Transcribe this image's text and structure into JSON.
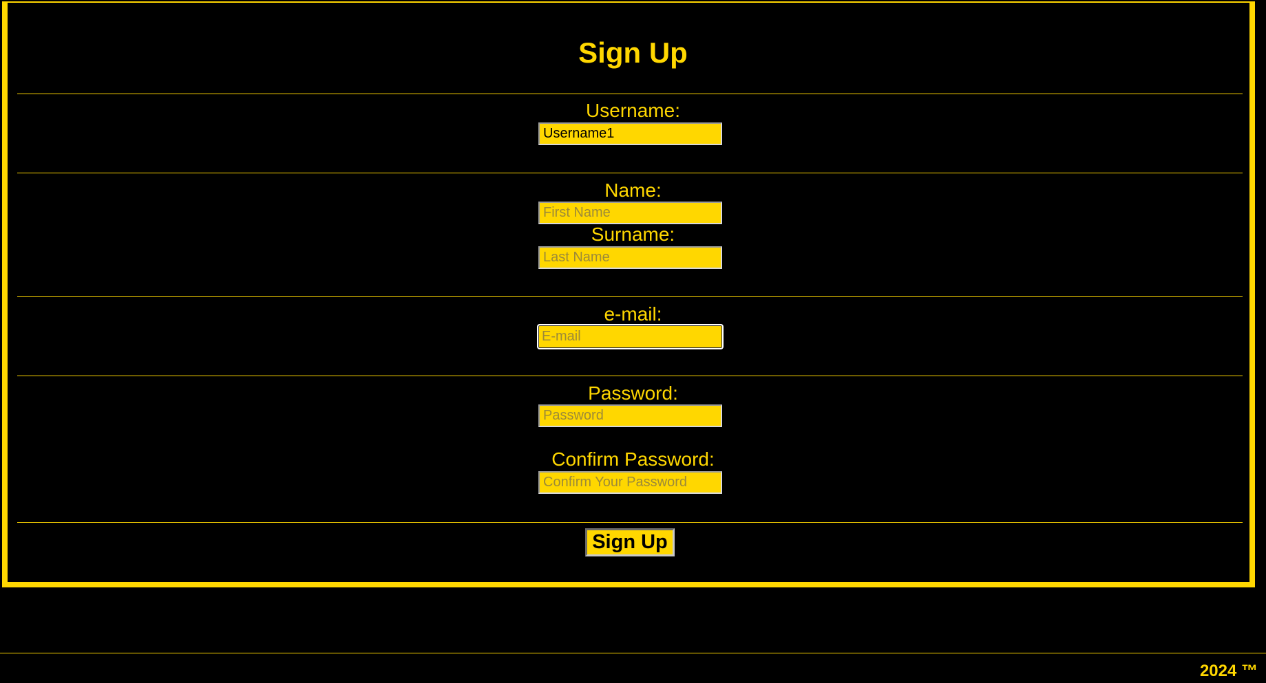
{
  "page": {
    "title": "Sign Up"
  },
  "form": {
    "username": {
      "label": "Username:",
      "value": "Username1",
      "placeholder": ""
    },
    "name": {
      "label": "Name:",
      "value": "",
      "placeholder": "First Name"
    },
    "surname": {
      "label": "Surname:",
      "value": "",
      "placeholder": "Last Name"
    },
    "email": {
      "label": "e-mail:",
      "value": "",
      "placeholder": "E-mail"
    },
    "password": {
      "label": "Password:",
      "value": "",
      "placeholder": "Password"
    },
    "confirm_password": {
      "label": "Confirm Password:",
      "value": "",
      "placeholder": "Confirm Your Password"
    },
    "submit_label": "Sign Up"
  },
  "footer": {
    "text": "2024 ™"
  },
  "colors": {
    "background": "#000000",
    "accent": "#FFD700",
    "field_text": "#000000",
    "placeholder": "#9c8a38"
  }
}
